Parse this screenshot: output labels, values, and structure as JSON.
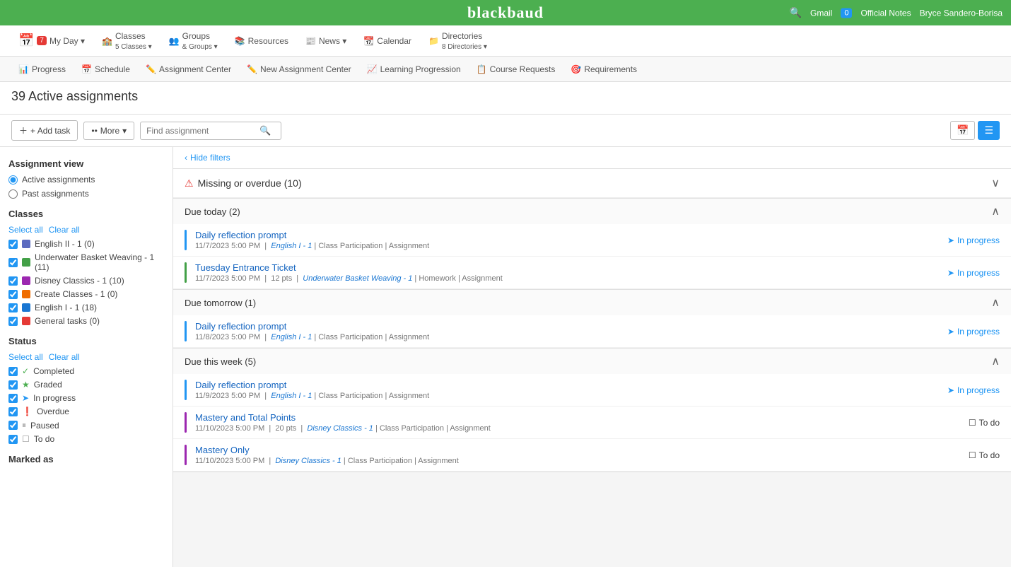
{
  "topbar": {
    "logo": "blackbaud",
    "search_label": "🔍",
    "gmail": "Gmail",
    "notes_count": "0",
    "notes_label": "Official Notes",
    "user_name": "Bryce Sandero-Borisa"
  },
  "secondary_nav": {
    "items": [
      {
        "label": "My Day",
        "badge": "7",
        "icon": "📅"
      },
      {
        "label": "5 Classes",
        "pre": "Classes",
        "icon": "🏫"
      },
      {
        "label": "& Groups",
        "pre": "Groups",
        "icon": "👥"
      },
      {
        "label": "Resources",
        "icon": "📚"
      },
      {
        "label": "News",
        "icon": "📰"
      },
      {
        "label": "Calendar",
        "icon": "📆"
      },
      {
        "label": "8 Directories",
        "pre": "Directories",
        "icon": "📁"
      }
    ]
  },
  "tertiary_nav": {
    "items": [
      {
        "label": "Progress",
        "icon": "📊"
      },
      {
        "label": "Schedule",
        "icon": "📅"
      },
      {
        "label": "Assignment Center",
        "icon": "✏️"
      },
      {
        "label": "New Assignment Center",
        "icon": "✏️"
      },
      {
        "label": "Learning Progression",
        "icon": "📈"
      },
      {
        "label": "Course Requests",
        "icon": "📋"
      },
      {
        "label": "Requirements",
        "icon": "🎯"
      }
    ]
  },
  "page": {
    "title": "39 Active assignments",
    "add_task_label": "+ Add task",
    "more_label": "•• More",
    "search_placeholder": "Find assignment",
    "hide_filters": "Hide filters"
  },
  "sidebar": {
    "assignment_view_title": "Assignment view",
    "view_options": [
      {
        "label": "Active assignments",
        "checked": true
      },
      {
        "label": "Past assignments",
        "checked": false
      }
    ],
    "classes_title": "Classes",
    "select_all": "Select all",
    "clear_all": "Clear all",
    "classes": [
      {
        "label": "English II - 1 (0)",
        "color": "#5c6bc0",
        "checked": true
      },
      {
        "label": "Underwater Basket Weaving - 1 (11)",
        "color": "#43a047",
        "checked": true
      },
      {
        "label": "Disney Classics - 1 (10)",
        "color": "#9c27b0",
        "checked": true
      },
      {
        "label": "Create Classes - 1 (0)",
        "color": "#ef6c00",
        "checked": true
      },
      {
        "label": "English I - 1 (18)",
        "color": "#1976d2",
        "checked": true
      },
      {
        "label": "General tasks (0)",
        "color": "#e53935",
        "checked": true
      }
    ],
    "status_title": "Status",
    "statuses": [
      {
        "label": "Completed",
        "icon": "✓",
        "icon_color": "#4caf50",
        "checked": true
      },
      {
        "label": "Graded",
        "icon": "★",
        "icon_color": "#4caf50",
        "checked": true
      },
      {
        "label": "In progress",
        "icon": "➤",
        "icon_color": "#2196F3",
        "checked": true
      },
      {
        "label": "Overdue",
        "icon": "❗",
        "icon_color": "#e53935",
        "checked": true
      },
      {
        "label": "Paused",
        "icon": "⏸",
        "icon_color": "#9e9e9e",
        "checked": true
      },
      {
        "label": "To do",
        "icon": "☐",
        "icon_color": "#999",
        "checked": true
      }
    ],
    "marked_as_title": "Marked as"
  },
  "main": {
    "missing_overdue": {
      "title": "Missing or overdue (10)",
      "collapsed": false
    },
    "due_today": {
      "title": "Due today (2)",
      "assignments": [
        {
          "name": "Daily reflection prompt",
          "date": "11/7/2023 5:00 PM",
          "class_link": "English I - 1",
          "category": "Class Participation",
          "type": "Assignment",
          "status": "In progress",
          "bar_color": "#2196F3"
        },
        {
          "name": "Tuesday Entrance Ticket",
          "date": "11/7/2023 5:00 PM",
          "pts": "12 pts",
          "class_link": "Underwater Basket Weaving - 1",
          "category": "Homework",
          "type": "Assignment",
          "status": "In progress",
          "bar_color": "#43a047"
        }
      ]
    },
    "due_tomorrow": {
      "title": "Due tomorrow (1)",
      "assignments": [
        {
          "name": "Daily reflection prompt",
          "date": "11/8/2023 5:00 PM",
          "class_link": "English I - 1",
          "category": "Class Participation",
          "type": "Assignment",
          "status": "In progress",
          "bar_color": "#2196F3"
        }
      ]
    },
    "due_this_week": {
      "title": "Due this week (5)",
      "assignments": [
        {
          "name": "Daily reflection prompt",
          "date": "11/9/2023 5:00 PM",
          "class_link": "English I - 1",
          "category": "Class Participation",
          "type": "Assignment",
          "status": "In progress",
          "bar_color": "#2196F3"
        },
        {
          "name": "Mastery and Total Points",
          "date": "11/10/2023 5:00 PM",
          "pts": "20 pts",
          "class_link": "Disney Classics - 1",
          "category": "Class Participation",
          "type": "Assignment",
          "status": "To do",
          "bar_color": "#9c27b0"
        },
        {
          "name": "Mastery Only",
          "date": "11/10/2023 5:00 PM",
          "class_link": "Disney Classics - 1",
          "category": "Class Participation",
          "type": "Assignment",
          "status": "To do",
          "bar_color": "#9c27b0"
        }
      ]
    }
  }
}
